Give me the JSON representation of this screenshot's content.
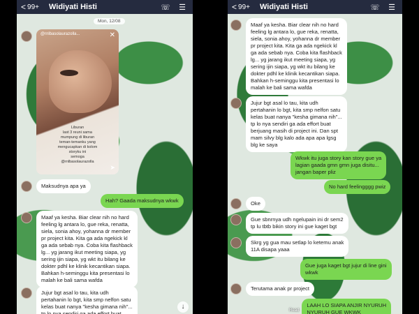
{
  "left": {
    "header": {
      "back": "<",
      "count": "99+",
      "name": "Widiyati Histi",
      "phone_icon": "phone-icon",
      "menu_icon": "menu-icon"
    },
    "date": "Mon, 12/08",
    "story": {
      "top": "@rnlbasolaurazolla...",
      "overlay": "Liburan\nlast 3 reuni sama\nmumpung di liburan\nteman-temanku yang\nmengucapkan di kolom\nstoryku ini\nsemoga\n@rnlbasolaurazolla"
    },
    "messages": [
      {
        "dir": "in",
        "text": "Maksudnya apa ya"
      },
      {
        "dir": "out",
        "text": "Hah? Gaada maksudnya wkwk"
      },
      {
        "dir": "in",
        "text": "Maaf ya kesha. Biar clear nih no hard\nfeeling lg antara lo, gue reka,  renatta,\nsiela, sonia ahoy, yohanna dr member\npr project kita. Kita ga ada ngekick kl\nga ada sebab nya. Coba kita flashback\nlg... yg jarang ikut meeting siapa, yg\nsering ijin siapa, yg wkt itu bilang ke\ndokter pdhl ke klinik kecantikan siapa.\nBahkan h-seminggu kita presentasi lo\nmalah ke bali sama wafda"
      },
      {
        "dir": "in",
        "text": "Jujur bgt asal lo tau, kita udh\npertahanin lo bgt, kita smp nelfon satu\nkelas buat nanya \"kesha gimana nih\"...\ntp lo nya sendiri ga ada effort buat"
      }
    ]
  },
  "right": {
    "header": {
      "back": "<",
      "count": "99+",
      "name": "Widiyati Histi",
      "phone_icon": "phone-icon",
      "menu_icon": "menu-icon"
    },
    "messages": [
      {
        "dir": "in",
        "text": "Maaf ya kesha. Biar clear nih no hard\nfeeling lg antara lo, gue reka,  renatta,\nsiela, sonia ahoy, yohanna dr member\npr project kita. Kita ga ada ngekick kl\nga ada sebab nya. Coba kita flashback\nlg... yg jarang ikut meeting siapa, yg\nsering ijin siapa, yg wkt itu bilang ke\ndokter pdhl ke klinik kecantikan siapa.\nBahkan h-seminggu kita presentasi lo\nmalah ke bali sama wafda"
      },
      {
        "dir": "in",
        "text": "Jujur bgt asal lo tau, kita udh\npertahanin lo bgt, kita smp nelfon satu\nkelas buat nanya \"kesha gimana nih\"...\ntp lo nya sendiri ga ada effort buat\nberjuang masih di project ini. Dan spt\nmam silvy blg kalo ada apa apa lgsg\nblg ke saya"
      },
      {
        "dir": "out",
        "text": "Wkwk itu juga story kan story gue ya\nlagian gaada gmn gmn juga disitu...\njangan baper pliz"
      },
      {
        "dir": "out",
        "text": "No hard feelingggg pwiz"
      },
      {
        "dir": "in",
        "text": "Oke"
      },
      {
        "dir": "in",
        "text": "Gue sbnrnya udh ngelupain ini dr sem2\ntp lu tbtb bikin story ini gue kaget bgt"
      },
      {
        "dir": "in",
        "text": "Skrg yg gua mau setlap lo ketemu anak\n11A disapa yaaa"
      },
      {
        "dir": "out",
        "text": "Gue juga kaget bgt jujur di line gini\nwkwk"
      },
      {
        "dir": "in",
        "text": "Terutama anak pr project"
      },
      {
        "dir": "out",
        "text": "LAAH LO SIAPA ANJIR NYURUH\nNYURUH GUE WKWK"
      }
    ],
    "read_label": "Read"
  }
}
